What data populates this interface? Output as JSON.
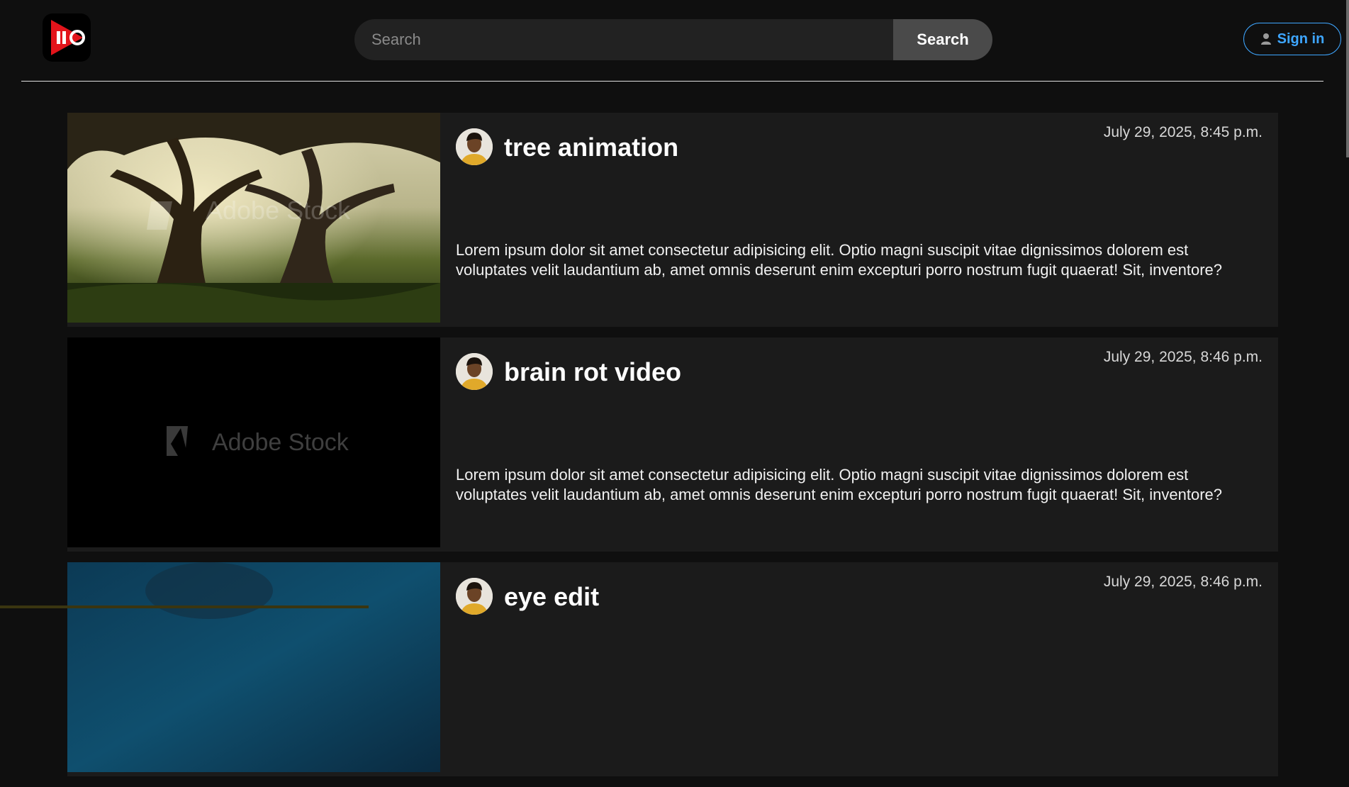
{
  "header": {
    "search_placeholder": "Search",
    "search_button": "Search",
    "signin_label": "Sign in",
    "logo_icon": "play-pause-logo-icon",
    "signin_icon": "user-icon"
  },
  "colors": {
    "background": "#0f0f0f",
    "card": "#1b1b1b",
    "accent_blue": "#3ea6ff",
    "logo_red": "#e3141b"
  },
  "videos": [
    {
      "title": "tree animation",
      "date": "July 29, 2025, 8:45 p.m.",
      "description": "Lorem ipsum dolor sit amet consectetur adipisicing elit. Optio magni suscipit vitae dignissimos dolorem est voluptates velit laudantium ab, amet omnis deserunt enim excepturi porro nostrum fugit quaerat! Sit, inventore?",
      "thumbnail": "tree-landscape",
      "watermark": "Adobe Stock"
    },
    {
      "title": "brain rot video",
      "date": "July 29, 2025, 8:46 p.m.",
      "description": "Lorem ipsum dolor sit amet consectetur adipisicing elit. Optio magni suscipit vitae dignissimos dolorem est voluptates velit laudantium ab, amet omnis deserunt enim excepturi porro nostrum fugit quaerat! Sit, inventore?",
      "thumbnail": "black-frame",
      "watermark": "Adobe Stock"
    },
    {
      "title": "eye edit",
      "date": "July 29, 2025, 8:46 p.m.",
      "description": "",
      "thumbnail": "blue-frame",
      "watermark": ""
    }
  ]
}
